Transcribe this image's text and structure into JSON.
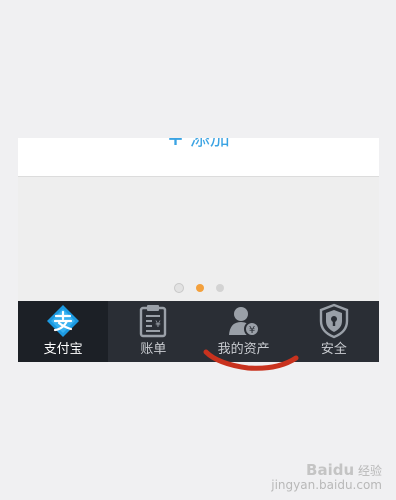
{
  "add_card": {
    "plus_icon": "plus-icon",
    "label": "添加"
  },
  "pager": {
    "dots": [
      "inactive",
      "active",
      "inactive"
    ],
    "active_color": "#f3a03c"
  },
  "tabbar": {
    "background": "#2a2e35",
    "tabs": [
      {
        "label": "支付宝",
        "icon": "alipay-logo-icon",
        "active": true
      },
      {
        "label": "账单",
        "icon": "bill-icon",
        "active": false
      },
      {
        "label": "我的资产",
        "icon": "assets-person-icon",
        "active": false
      },
      {
        "label": "安全",
        "icon": "security-shield-icon",
        "active": false
      }
    ]
  },
  "annotation": {
    "icon": "red-underline-mark",
    "color": "#c8321e"
  },
  "watermark": {
    "logo": "Baidu",
    "text": "经验",
    "url": "jingyan.baidu.com"
  }
}
